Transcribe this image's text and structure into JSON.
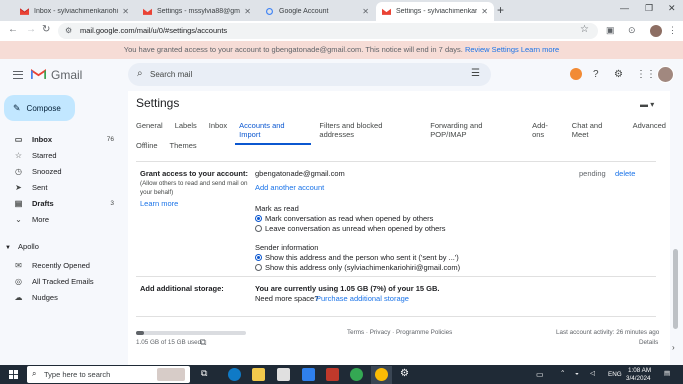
{
  "browser": {
    "tabs": [
      {
        "title": "Inbox - sylviachimenkariohiri"
      },
      {
        "title": "Settings - mssylvia88@gmail.co"
      },
      {
        "title": "Google Account"
      },
      {
        "title": "Settings - sylviachimenkariohiri"
      }
    ],
    "address": "mail.google.com/mail/u/0/#settings/accounts"
  },
  "banner": {
    "text": "You have granted access to your account to gbengatonade@gmail.com. This notice will end in 7 days.",
    "review_link": "Review Settings",
    "learn_link": "Learn more"
  },
  "header": {
    "app_name": "Gmail",
    "search_placeholder": "Search mail"
  },
  "sidebar": {
    "compose_label": "Compose",
    "items": [
      {
        "label": "Inbox",
        "count": "76"
      },
      {
        "label": "Starred",
        "count": ""
      },
      {
        "label": "Snoozed",
        "count": ""
      },
      {
        "label": "Sent",
        "count": ""
      },
      {
        "label": "Drafts",
        "count": "3"
      },
      {
        "label": "More",
        "count": ""
      }
    ],
    "apollo_label": "Apollo",
    "apollo_items": [
      {
        "label": "Recently Opened"
      },
      {
        "label": "All Tracked Emails"
      },
      {
        "label": "Nudges"
      }
    ]
  },
  "settings": {
    "title": "Settings",
    "tabs_row1": [
      "General",
      "Labels",
      "Inbox",
      "Accounts and Import",
      "Filters and blocked addresses",
      "Forwarding and POP/IMAP",
      "Add-ons",
      "Chat and Meet",
      "Advanced"
    ],
    "tabs_row2": [
      "Offline",
      "Themes"
    ],
    "grant_access": {
      "label": "Grant access to your account:",
      "desc": "(Allow others to read and send mail on your behalf)",
      "learn_more": "Learn more",
      "email": "gbengatonade@gmail.com",
      "status": "pending",
      "delete": "delete",
      "add_account": "Add another account",
      "mark_as_read_title": "Mark as read",
      "mark_option_1": "Mark conversation as read when opened by others",
      "mark_option_2": "Leave conversation as unread when opened by others",
      "sender_info_title": "Sender information",
      "sender_option_1": "Show this address and the person who sent it ('sent by ...')",
      "sender_option_2": "Show this address only (sylviachimenkariohiri@gmail.com)"
    },
    "storage": {
      "label": "Add additional storage:",
      "usage": "You are currently using 1.05 GB (7%) of your 15 GB.",
      "need_more": "Need more space?",
      "purchase_link": "Purchase additional storage",
      "used_fraction": 0.07
    },
    "footer": {
      "storage_text": "1.05 GB of 15 GB used",
      "terms": "Terms · Privacy · Programme Policies",
      "activity": "Last account activity: 26 minutes ago",
      "details": "Details"
    }
  },
  "taskbar": {
    "search_placeholder": "Type here to search",
    "language": "ENG",
    "time": "1:08 AM",
    "date": "3/4/2024"
  },
  "colors": {
    "accent": "#0b57d0",
    "compose_bg": "#c2e7ff",
    "banner_bg": "#f6dcd6",
    "gmail_red": "#ea4335"
  }
}
